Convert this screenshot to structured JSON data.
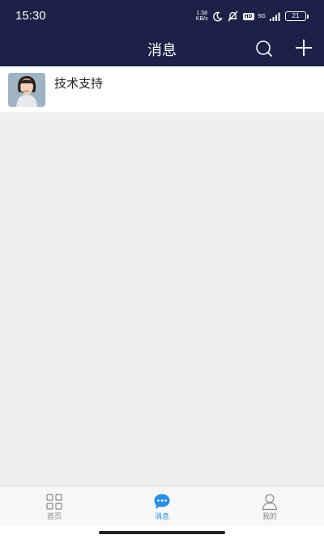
{
  "status_bar": {
    "time": "15:30",
    "net_speed_value": "1.58",
    "net_speed_unit": "KB/s",
    "hd": "HD",
    "network": "5G",
    "battery": "21"
  },
  "nav": {
    "title": "消息"
  },
  "conversations": [
    {
      "name": "技术支持",
      "avatar_icon": "support-agent-avatar"
    }
  ],
  "tabs": [
    {
      "label": "首页",
      "icon": "grid-icon",
      "active": false
    },
    {
      "label": "消息",
      "icon": "chat-bubble-icon",
      "active": true
    },
    {
      "label": "我的",
      "icon": "person-icon",
      "active": false
    }
  ],
  "colors": {
    "header": "#1b2147",
    "accent": "#2a8fde",
    "background": "#efefef"
  }
}
